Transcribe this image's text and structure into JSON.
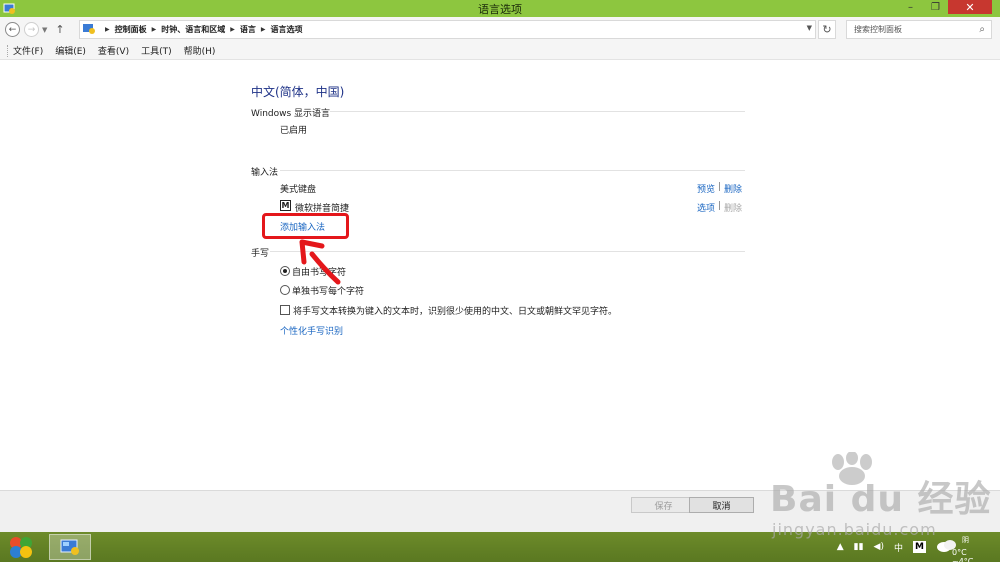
{
  "window": {
    "title": "语言选项"
  },
  "window_controls": {
    "minimize": "–",
    "restore": "❐",
    "close": "✕"
  },
  "addressbar": {
    "back": "←",
    "forward": "→",
    "up": "↑",
    "breadcrumbs": [
      "控制面板",
      "时钟、语言和区域",
      "语言",
      "语言选项"
    ],
    "search_placeholder": "搜索控制面板",
    "refresh": "↻"
  },
  "menu": {
    "items": [
      "文件(F)",
      "编辑(E)",
      "查看(V)",
      "工具(T)",
      "帮助(H)"
    ]
  },
  "language": {
    "name": "中文(简体，中国)",
    "display_section": {
      "heading": "Windows 显示语言",
      "status": "已启用"
    },
    "input_section": {
      "heading": "输入法",
      "methods": [
        {
          "name": "美式键盘",
          "action1": "预览",
          "action2": "删除"
        },
        {
          "name": "微软拼音简捷",
          "action1": "选项",
          "action2": "删除",
          "icon_letter": "M"
        }
      ],
      "add_link": "添加输入法"
    },
    "handwriting_section": {
      "heading": "手写",
      "options": [
        "自由书写字符",
        "单独书写每个字符"
      ],
      "selected_option": 0,
      "checkbox_label": "将手写文本转换为键入的文本时，识别很少使用的中文、日文或朝鲜文罕见字符。",
      "personalize_link": "个性化手写识别"
    }
  },
  "footer": {
    "save": "保存",
    "cancel": "取消"
  },
  "taskbar": {
    "tray": {
      "ime_lang": "中",
      "ime_mode": "M",
      "weather_label": "阴",
      "weather_temp": "0°C ~4°C"
    }
  },
  "watermark": {
    "brand": "Bai du 经验",
    "site": "jingyan.baidu.com"
  },
  "colors": {
    "titlebar": "#8dc63f",
    "link": "#1a66c2",
    "highlight": "#e4171b",
    "taskbar": "#6d8b2a"
  }
}
